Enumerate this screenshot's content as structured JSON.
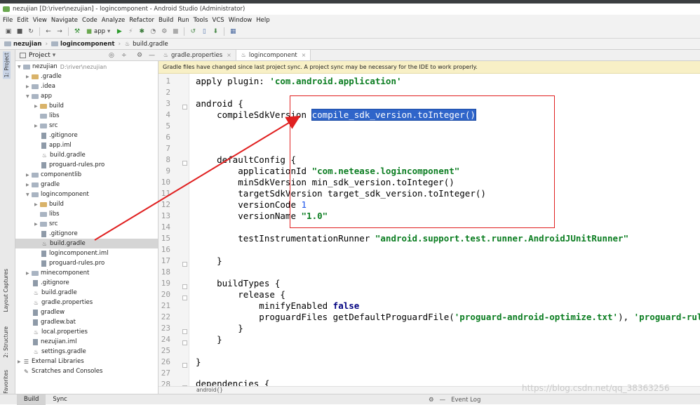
{
  "window": {
    "title": "nezujian [D:\\river\\nezujian] - logincomponent - Android Studio (Administrator)"
  },
  "menu": [
    "File",
    "Edit",
    "View",
    "Navigate",
    "Code",
    "Analyze",
    "Refactor",
    "Build",
    "Run",
    "Tools",
    "VCS",
    "Window",
    "Help"
  ],
  "toolbar": {
    "run_config": "app"
  },
  "breadcrumb": [
    "nezujian",
    "logincomponent",
    "build.gradle"
  ],
  "side_tabs": {
    "project": "1: Project",
    "captures": "Layout Captures",
    "structure": "2: Structure",
    "favorites": "2: Favorites"
  },
  "project_panel": {
    "title": "Project",
    "tree": [
      {
        "label": "nezujian",
        "hint": "D:\\river\\nezujian"
      },
      {
        "label": ".gradle"
      },
      {
        "label": ".idea"
      },
      {
        "label": "app"
      },
      {
        "label": "build"
      },
      {
        "label": "libs"
      },
      {
        "label": "src"
      },
      {
        "label": ".gitignore"
      },
      {
        "label": "app.iml"
      },
      {
        "label": "build.gradle"
      },
      {
        "label": "proguard-rules.pro"
      },
      {
        "label": "componentlib"
      },
      {
        "label": "gradle"
      },
      {
        "label": "logincomponent"
      },
      {
        "label": "build"
      },
      {
        "label": "libs"
      },
      {
        "label": "src"
      },
      {
        "label": ".gitignore"
      },
      {
        "label": "build.gradle"
      },
      {
        "label": "logincomponent.iml"
      },
      {
        "label": "proguard-rules.pro"
      },
      {
        "label": "minecomponent"
      },
      {
        "label": ".gitignore"
      },
      {
        "label": "build.gradle"
      },
      {
        "label": "gradle.properties"
      },
      {
        "label": "gradlew"
      },
      {
        "label": "gradlew.bat"
      },
      {
        "label": "local.properties"
      },
      {
        "label": "nezujian.iml"
      },
      {
        "label": "settings.gradle"
      },
      {
        "label": "External Libraries"
      },
      {
        "label": "Scratches and Consoles"
      }
    ]
  },
  "editor": {
    "tabs": [
      "gradle.properties",
      "logincomponent"
    ],
    "banner": "Gradle files have changed since last project sync. A project sync may be necessary for the IDE to work properly.",
    "line_numbers": [
      "1",
      "2",
      "3",
      "4",
      "5",
      "6",
      "7",
      "8",
      "9",
      "10",
      "11",
      "12",
      "13",
      "14",
      "15",
      "16",
      "17",
      "18",
      "19",
      "20",
      "21",
      "22",
      "23",
      "24",
      "25",
      "26",
      "27",
      "28"
    ],
    "code": {
      "l1a": "apply plugin: ",
      "l1b": "'com.android.application'",
      "l3": "android {",
      "l4a": "    compileSdkVersion ",
      "l4b": "compile_sdk_version.toInteger()",
      "l8": "    defaultConfig {",
      "l9a": "        applicationId ",
      "l9b": "\"com.netease.logincomponent\"",
      "l10": "        minSdkVersion min_sdk_version.toInteger()",
      "l11": "        targetSdkVersion target_sdk_version.toInteger()",
      "l12a": "        versionCode ",
      "l12b": "1",
      "l13a": "        versionName ",
      "l13b": "\"1.0\"",
      "l15a": "        testInstrumentationRunner ",
      "l15b": "\"android.support.test.runner.AndroidJUnitRunner\"",
      "l17": "    }",
      "l19": "    buildTypes {",
      "l20": "        release {",
      "l21a": "            minifyEnabled ",
      "l21b": "false",
      "l22a": "            proguardFiles getDefaultProguardFile(",
      "l22b": "'proguard-android-optimize.txt'",
      "l22c": "), ",
      "l22d": "'proguard-rules.",
      "l23": "        }",
      "l24": "    }",
      "l26": "}",
      "l28": "dependencies {"
    },
    "status_crumb": "android{}"
  },
  "bottom": {
    "tabs": [
      "Build",
      "Sync"
    ],
    "event_log": "Event Log"
  },
  "watermark": "https://blog.csdn.net/qq_38363256",
  "colors": {
    "annotation_red": "#e02020",
    "selection_blue": "#2f65ca",
    "string_green": "#0b7d21",
    "banner_yellow": "#f8f0c6"
  }
}
